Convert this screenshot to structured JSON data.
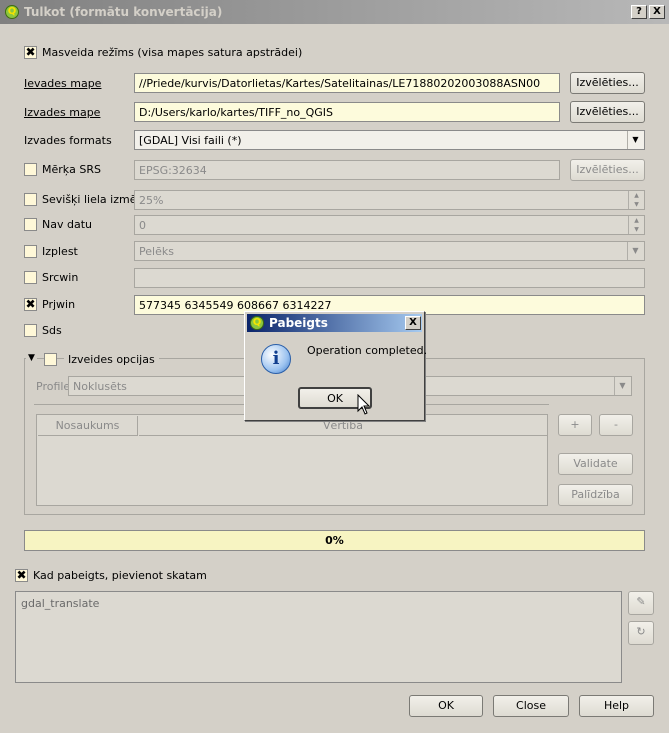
{
  "window": {
    "title": "Tulkot (formātu konvertācija)",
    "help_glyph": "?",
    "close_glyph": "X"
  },
  "batch": {
    "checked": "✖",
    "label": "Masveida režīms (visa mapes satura apstrādei)"
  },
  "rows": {
    "input_dir": {
      "label": "Ievades mape",
      "value": "//Priede/kurvis/Datorlietas/Kartes/Satelitainas/LE71880202003088ASN00",
      "button": "Izvēlēties..."
    },
    "output_dir": {
      "label": "Izvades mape",
      "value": "D:/Users/karlo/kartes/TIFF_no_QGIS",
      "button": "Izvēlēties..."
    },
    "output_format": {
      "label": "Izvades formats",
      "value": "[GDAL] Visi faili (*)"
    },
    "target_srs": {
      "label": "Mērķa SRS",
      "value": "EPSG:32634",
      "button": "Izvēlēties..."
    },
    "outsize": {
      "label": "Sevišķi liela izmēr",
      "value": "25%"
    },
    "nodata": {
      "label": "Nav datu",
      "value": "0"
    },
    "expand": {
      "label": "Izplest",
      "value": "Pelēks"
    },
    "srcwin": {
      "label": "Srcwin",
      "value": ""
    },
    "prjwin": {
      "label": "Prjwin",
      "checked": "✖",
      "value": "577345 6345549 608667 6314227"
    },
    "sds": {
      "label": "Sds"
    }
  },
  "creation_options": {
    "toggle": "▼",
    "label": "Izveides opcijas",
    "profile_label": "Profile",
    "profile_value": "Noklusēts",
    "columns": [
      "Nosaukums",
      "Vērtība"
    ],
    "add": "+",
    "remove": "-",
    "validate": "Validate",
    "help": "Palīdzība"
  },
  "progress": {
    "value": 0,
    "label": "0%"
  },
  "load_into_canvas": {
    "checked": "✖",
    "label": "Kad pabeigts, pievienot skatam"
  },
  "command": {
    "text": "gdal_translate"
  },
  "footer": {
    "ok": "OK",
    "close": "Close",
    "help": "Help"
  },
  "dialog": {
    "title": "Pabeigts",
    "close_glyph": "X",
    "message": "Operation completed.",
    "ok": "OK",
    "icon": "info-icon"
  },
  "colors": {
    "field_bg": "#fdfbdc",
    "titlebar": "#808080",
    "dialog_title": "#0a246a"
  }
}
